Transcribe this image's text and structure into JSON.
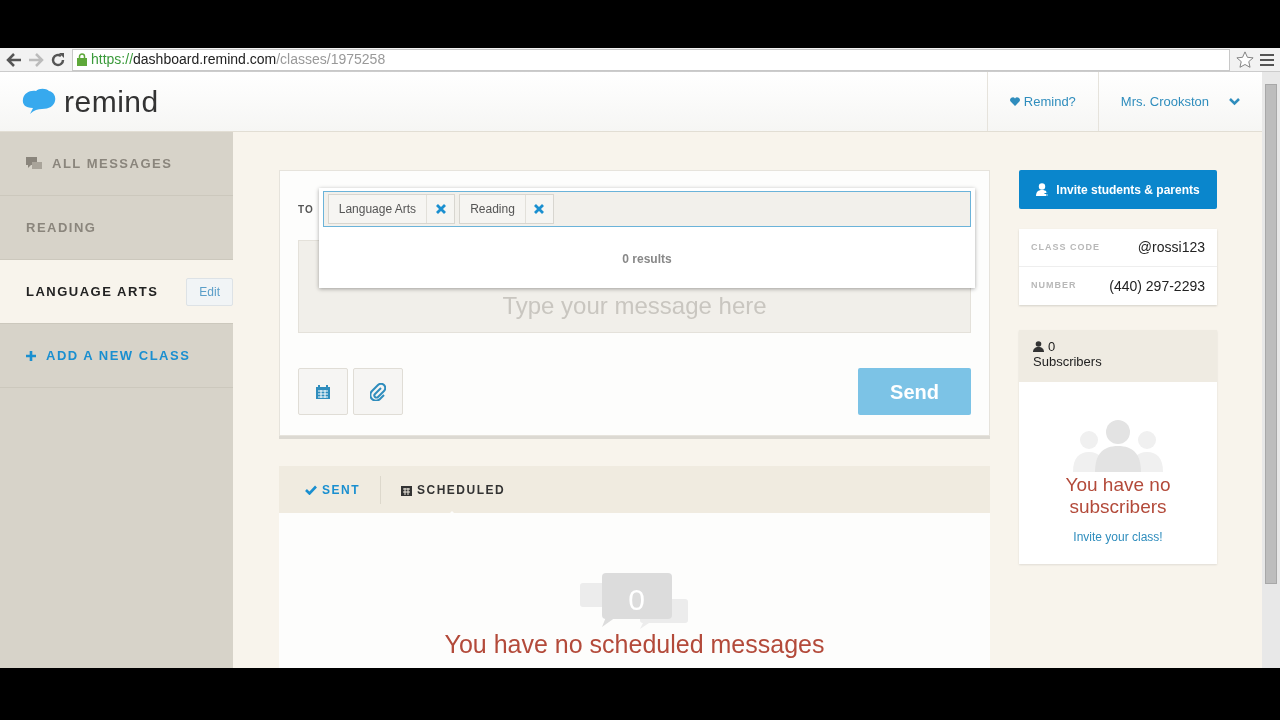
{
  "browser": {
    "url_scheme": "https://",
    "url_host": "dashboard.remind.com",
    "url_path": "/classes/1975258"
  },
  "header": {
    "logo": "remind",
    "link": "Remind?",
    "user": "Mrs. Crookston"
  },
  "sidebar": {
    "items": [
      {
        "label": "ALL MESSAGES",
        "kind": "messages",
        "selected": false
      },
      {
        "label": "READING",
        "kind": "class",
        "selected": false
      },
      {
        "label": "LANGUAGE ARTS",
        "kind": "class",
        "selected": true,
        "action": "Edit"
      },
      {
        "label": "ADD A NEW CLASS",
        "kind": "add",
        "selected": false
      }
    ]
  },
  "composer": {
    "to_label": "TO",
    "recipients": [
      {
        "label": "Language Arts"
      },
      {
        "label": "Reading"
      }
    ],
    "results": "0 results",
    "message": {
      "placeholder": "Type your message here"
    },
    "send": "Send",
    "send_disabled": true
  },
  "messages": {
    "tabs": [
      {
        "label": "SENT",
        "kind": "sent",
        "selected": false
      },
      {
        "label": "SCHEDULED",
        "kind": "scheduled",
        "selected": true
      }
    ],
    "empty_count": "0",
    "empty_text": "You have no scheduled messages"
  },
  "invite_button": "Invite students & parents",
  "class_info": [
    {
      "label": "CLASS CODE",
      "value": "@rossi123"
    },
    {
      "label": "NUMBER",
      "value": "(440) 297-2293"
    }
  ],
  "subscribers": {
    "count": "0",
    "label": "Subscribers",
    "empty_text": "You have no subscribers",
    "link": "Invite your class!"
  }
}
